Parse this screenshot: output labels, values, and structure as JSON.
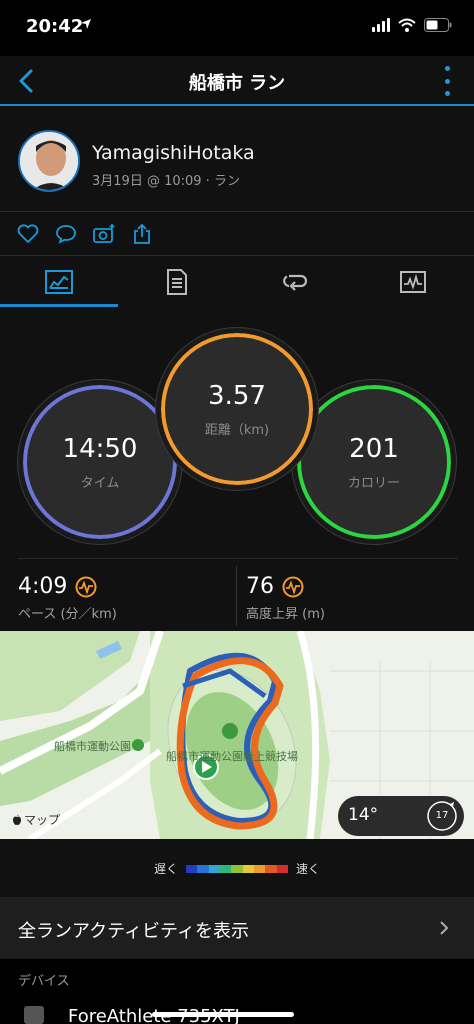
{
  "status_bar": {
    "time": "20:42"
  },
  "nav": {
    "title": "船橋市 ラン"
  },
  "profile": {
    "name": "YamagishiHotaka",
    "date_line": "3月19日 @ 10:09 · ラン"
  },
  "stats": {
    "time": {
      "value": "14:50",
      "label": "タイム",
      "color": "#5ea0e8"
    },
    "distance": {
      "value": "3.57",
      "label": "距離（km)",
      "color": "#f39a2e"
    },
    "calories": {
      "value": "201",
      "label": "カロリー",
      "color": "#2bd640"
    },
    "pace": {
      "value": "4:09",
      "label": "ペース (分／km)"
    },
    "elevation": {
      "value": "76",
      "label": "高度上昇 (m)"
    }
  },
  "map": {
    "park_label": "船橋市運動公園",
    "stadium_label": "船橋市運動公園陸上競技場",
    "attribution": "マップ",
    "temperature": "14°",
    "wind_speed": "17"
  },
  "legend": {
    "slow_label": "遅く",
    "fast_label": "速く",
    "colors": [
      "#1e3fc2",
      "#2a72d8",
      "#36a2d0",
      "#2fb57a",
      "#8bc43a",
      "#e9c832",
      "#f19a2e",
      "#e35a24",
      "#d42d2d"
    ]
  },
  "all_activities_label": "全ランアクティビティを表示",
  "devices": {
    "title": "デバイス",
    "device_name": "ForeAthlete 735XTJ"
  }
}
